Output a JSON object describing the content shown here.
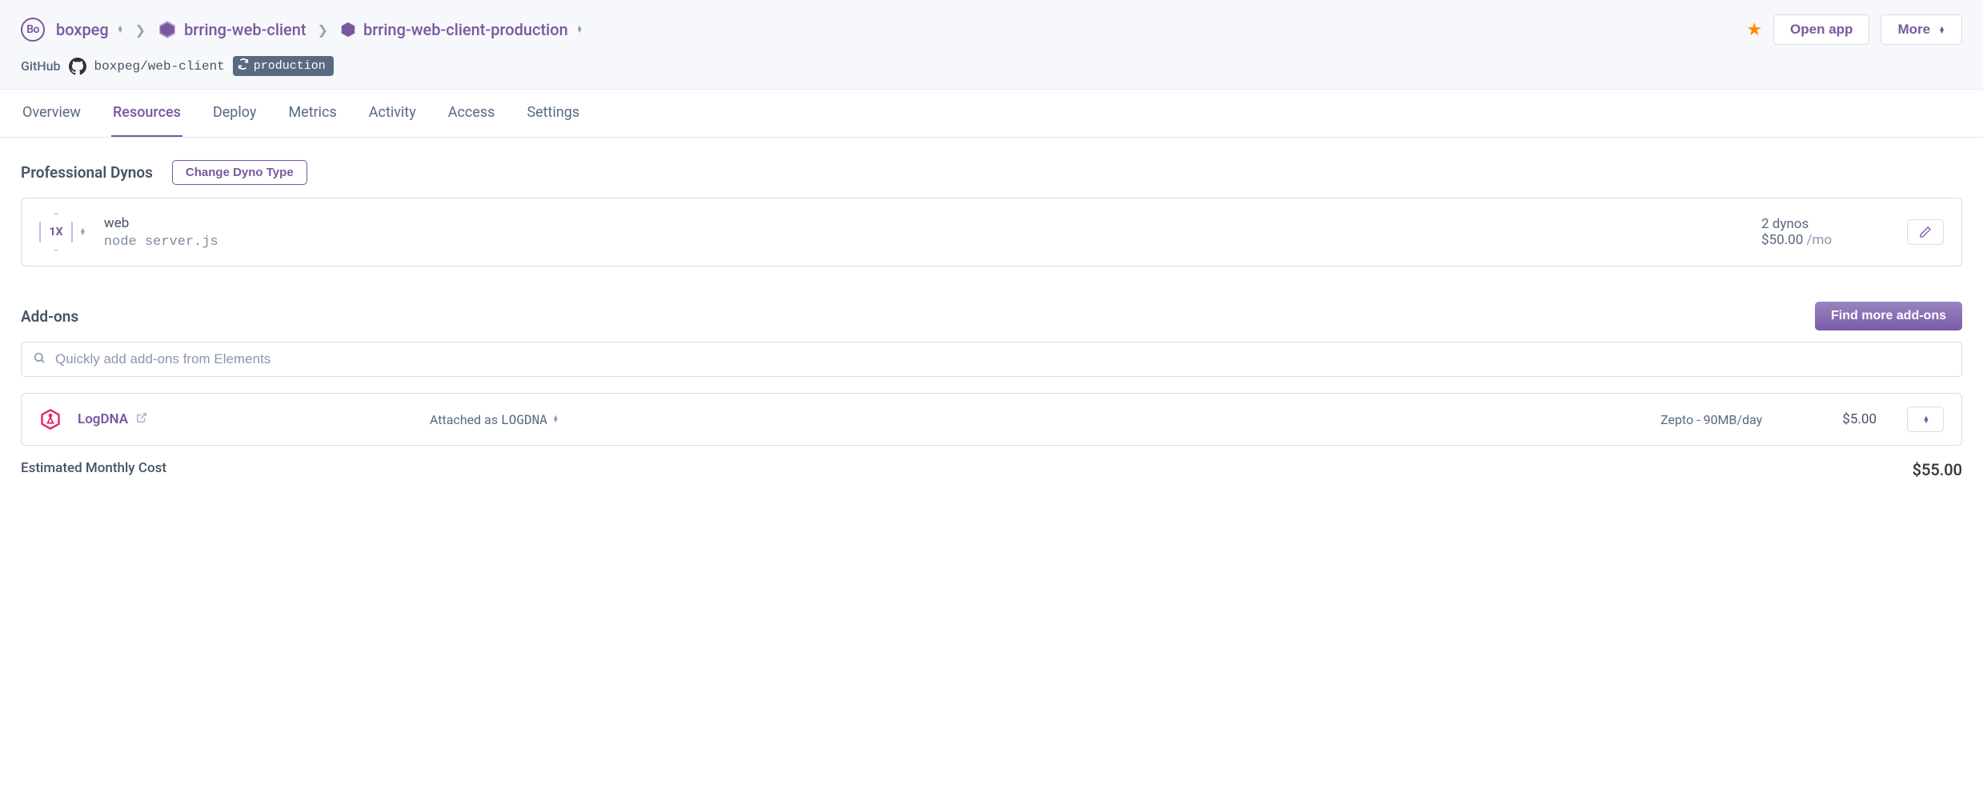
{
  "breadcrumb": {
    "org_avatar": "Bo",
    "org": "boxpeg",
    "pipeline": "brring-web-client",
    "app": "brring-web-client-production"
  },
  "header_actions": {
    "open_app": "Open app",
    "more": "More"
  },
  "github": {
    "label": "GitHub",
    "repo": "boxpeg/web-client",
    "env": "production"
  },
  "tabs": [
    {
      "label": "Overview",
      "active": false
    },
    {
      "label": "Resources",
      "active": true
    },
    {
      "label": "Deploy",
      "active": false
    },
    {
      "label": "Metrics",
      "active": false
    },
    {
      "label": "Activity",
      "active": false
    },
    {
      "label": "Access",
      "active": false
    },
    {
      "label": "Settings",
      "active": false
    }
  ],
  "dynos": {
    "section_title": "Professional Dynos",
    "change_btn": "Change Dyno Type",
    "badge": "1X",
    "name": "web",
    "cmd": "node server.js",
    "count": "2 dynos",
    "cost": "$50.00",
    "cost_suffix": "/mo"
  },
  "addons": {
    "section_title": "Add-ons",
    "find_more": "Find more add-ons",
    "search_placeholder": "Quickly add add-ons from Elements",
    "items": [
      {
        "name": "LogDNA",
        "attach_prefix": "Attached as",
        "attach_alias": "LOGDNA",
        "plan": "Zepto - 90MB/day",
        "cost": "$5.00"
      }
    ]
  },
  "summary": {
    "label": "Estimated Monthly Cost",
    "value": "$55.00"
  }
}
